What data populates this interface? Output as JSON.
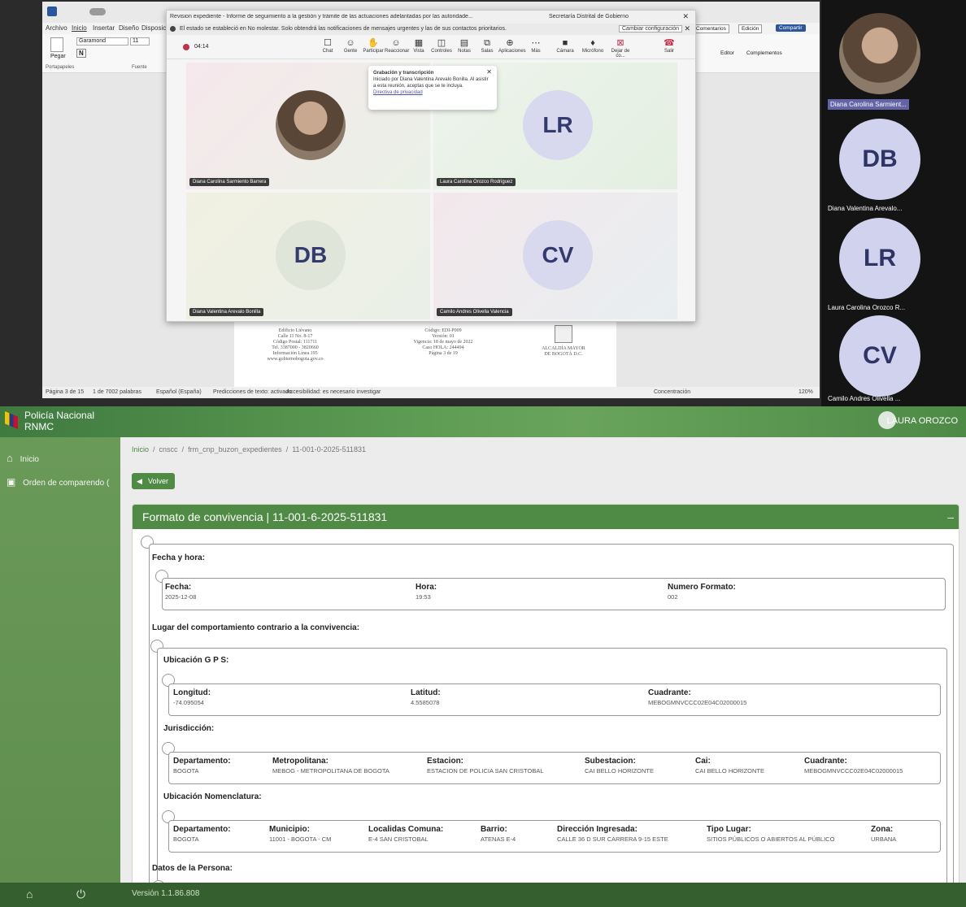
{
  "word": {
    "title": "Revision expediente - Informe de seguimiento a la gestión y trámite de las actuaciones adelantadas por las autoridade...",
    "meeting_name": "Secretaría Distrital de Gobierno",
    "menu": [
      "Archivo",
      "Inicio",
      "Insertar",
      "Diseño",
      "Disposicio"
    ],
    "font_name": "Garamond",
    "font_size": "11",
    "ribbon_groups": [
      "Portapapeles",
      "Fuente"
    ],
    "paste_label": "Pegar",
    "right_buttons": [
      "Comentarios",
      "Edición",
      "Compartir"
    ],
    "right_groups": [
      "Editor",
      "Complementos"
    ],
    "status": [
      "Página 3 de 15",
      "1 de 7002 palabras",
      "Español (España)",
      "Predicciones de texto: activado",
      "Accesibilidad: es necesario investigar",
      "Concentración",
      "120%"
    ],
    "footer_left": [
      "Edificio Liévano",
      "Calle 11 No. 8-17",
      "Código Postal: 111711",
      "Tel. 3387000 - 3820660",
      "Información Línea 195",
      "www.gobiernobogota.gov.co"
    ],
    "footer_mid": [
      "Código: EDI-P009",
      "Versión: 01",
      "Vigencia: 18 de mayo de 2022",
      "Caso HOLA: 244494",
      "Página 3 de 19"
    ],
    "footer_right": [
      "ALCALDÍA MAYOR",
      "DE BOGOTÁ D.C."
    ]
  },
  "teams": {
    "notice": "El estado se estableció en No molestar. Solo obtendrá las notificaciones de mensajes urgentes y las de sus contactos prioritarios.",
    "change_settings": "Cambiar configuración",
    "timer": "04:14",
    "toolbar": [
      "Chat",
      "Gente",
      "Participar",
      "Reaccionar",
      "Vista",
      "Controles",
      "Notas",
      "Salas",
      "Aplicaciones",
      "Más",
      "Cámara",
      "Micrófono",
      "Dejar de co...",
      "Salir"
    ],
    "popup_title": "Grabación y transcripción",
    "popup_body": "Iniciado por Diana Valentina Arevalo Bonilla. Al asistir a esta reunión, aceptas que se te incluya.",
    "popup_link": "Directiva de privacidad",
    "tiles": [
      {
        "initials": "",
        "name": "Diana Carolina Sarmiento Barrera",
        "color": "#f4e6ea"
      },
      {
        "initials": "LR",
        "name": "Laura Carolina Orozco Rodriguez",
        "color": "#e3efe1"
      },
      {
        "initials": "DB",
        "name": "Diana Valentina Arevalo Bonilla",
        "color": "#efece0"
      },
      {
        "initials": "CV",
        "name": "Camilo Andres Olivella Valencia",
        "color": "#f2e6ea"
      }
    ],
    "side_panel": [
      {
        "initials": "",
        "name": "Diana Carolina Sarmient..."
      },
      {
        "initials": "DB",
        "name": "Diana Valentina Arevalo..."
      },
      {
        "initials": "LR",
        "name": "Laura Carolina Orozco R..."
      },
      {
        "initials": "CV",
        "name": "Camilo Andres Olivella ..."
      }
    ]
  },
  "app": {
    "brand_line1": "Policía Nacional",
    "brand_line2": "RNMC",
    "user": "LAURA OROZCO",
    "sidebar": [
      "Inicio",
      "Orden de comparendo ("
    ],
    "breadcrumb": [
      "Inicio",
      "cnscc",
      "frm_cnp_buzon_expedientes",
      "11-001-0-2025-511831"
    ],
    "back": "Volver",
    "card_title": "Formato de convivencia | 11-001-6-2025-511831",
    "card_minimize": "–",
    "sections": {
      "fecha_hora": "Fecha y hora:",
      "lugar": "Lugar del comportamiento contrario a la convivencia:",
      "gps": "Ubicación G P S:",
      "jurisdiccion": "Jurisdicción:",
      "nomenclatura": "Ubicación Nomenclatura:",
      "persona": "Datos de la Persona:"
    },
    "fecha_fields": [
      {
        "label": "Fecha:",
        "value": "2025-12-08"
      },
      {
        "label": "Hora:",
        "value": "19:53"
      },
      {
        "label": "Numero Formato:",
        "value": "002"
      }
    ],
    "gps_fields": [
      {
        "label": "Longitud:",
        "value": "-74.095054"
      },
      {
        "label": "Latitud:",
        "value": "4.5585078"
      },
      {
        "label": "Cuadrante:",
        "value": "MEBOGMNVCCC02E04C02000015"
      }
    ],
    "jur_fields": [
      {
        "label": "Departamento:",
        "value": "BOGOTA"
      },
      {
        "label": "Metropolitana:",
        "value": "MEBOG - METROPOLITANA DE BOGOTA"
      },
      {
        "label": "Estacion:",
        "value": "ESTACION DE POLICIA SAN CRISTOBAL"
      },
      {
        "label": "Subestacion:",
        "value": "CAI BELLO HORIZONTE"
      },
      {
        "label": "Cai:",
        "value": "CAI BELLO HORIZONTE"
      },
      {
        "label": "Cuadrante:",
        "value": "MEBOGMNVCCC02E04C02000015"
      }
    ],
    "nom_fields": [
      {
        "label": "Departamento:",
        "value": "BOGOTA"
      },
      {
        "label": "Municipio:",
        "value": "11001 - BOGOTA - CM"
      },
      {
        "label": "Localidas Comuna:",
        "value": "E-4 SAN CRISTOBAL"
      },
      {
        "label": "Barrio:",
        "value": "ATENAS E-4"
      },
      {
        "label": "Dirección Ingresada:",
        "value": "CALLE 36 D SUR CARRERA 9-15 ESTE"
      },
      {
        "label": "Tipo Lugar:",
        "value": "SITIOS PÚBLICOS O ABIERTOS AL PÚBLICO"
      },
      {
        "label": "Zona:",
        "value": "URBANA"
      }
    ],
    "version": "Versión 1.1.86.808"
  },
  "colors": {
    "app_green": "#4f8b45",
    "teams_purple": "#6264a7",
    "teams_avatar": "#d0d2ee"
  }
}
